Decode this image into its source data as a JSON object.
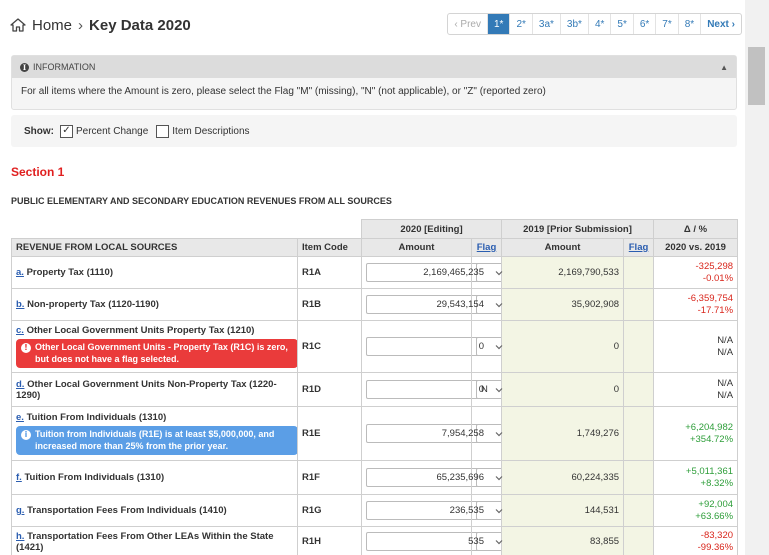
{
  "breadcrumb": {
    "home": "Home",
    "current": "Key Data 2020"
  },
  "pager": {
    "prev": "‹ Prev",
    "pages": [
      "1*",
      "2*",
      "3a*",
      "3b*",
      "4*",
      "5*",
      "6*",
      "7*",
      "8*"
    ],
    "active": "1*",
    "next": "Next ›"
  },
  "info": {
    "title": "INFORMATION",
    "text": "For all items where the Amount is zero, please select the Flag \"M\" (missing), \"N\" (not applicable), or \"Z\" (reported zero)"
  },
  "show": {
    "label": "Show:",
    "percent_change": "Percent Change",
    "percent_change_checked": true,
    "item_descriptions": "Item Descriptions",
    "item_descriptions_checked": false
  },
  "section": {
    "title": "Section 1",
    "subtitle": "PUBLIC ELEMENTARY AND SECONDARY EDUCATION REVENUES FROM ALL SOURCES"
  },
  "table": {
    "group_current": "2020 [Editing]",
    "group_prior": "2019 [Prior Submission]",
    "group_delta": "Δ / %",
    "col_name": "REVENUE FROM LOCAL SOURCES",
    "col_code": "Item Code",
    "col_amount": "Amount",
    "col_flag": "Flag",
    "col_prior_amount": "Amount",
    "col_prior_flag": "Flag",
    "col_delta": "2020 vs. 2019",
    "rows": [
      {
        "key": "a.",
        "name": "Property Tax (1110)",
        "code": "R1A",
        "amount": "2,169,465,235",
        "flag": "",
        "prior": "2,169,790,533",
        "delta1": "-325,298",
        "delta2": "-0.01%",
        "tone": "neg",
        "alert": "",
        "alert_type": ""
      },
      {
        "key": "b.",
        "name": "Non-property Tax (1120-1190)",
        "code": "R1B",
        "amount": "29,543,154",
        "flag": "",
        "prior": "35,902,908",
        "delta1": "-6,359,754",
        "delta2": "-17.71%",
        "tone": "neg",
        "alert": "",
        "alert_type": ""
      },
      {
        "key": "c.",
        "name": "Other Local Government Units Property Tax (1210)",
        "code": "R1C",
        "amount": "0",
        "flag": "",
        "prior": "0",
        "delta1": "N/A",
        "delta2": "N/A",
        "tone": "na",
        "alert": "Other Local Government Units - Property Tax (R1C) is zero, but does not have a flag selected.",
        "alert_type": "red"
      },
      {
        "key": "d.",
        "name": "Other Local Government Units Non-Property Tax (1220-1290)",
        "code": "R1D",
        "amount": "0",
        "flag": "N",
        "prior": "0",
        "delta1": "N/A",
        "delta2": "N/A",
        "tone": "na",
        "alert": "",
        "alert_type": ""
      },
      {
        "key": "e.",
        "name": "Tuition From Individuals (1310)",
        "code": "R1E",
        "amount": "7,954,258",
        "flag": "",
        "prior": "1,749,276",
        "delta1": "+6,204,982",
        "delta2": "+354.72%",
        "tone": "pos",
        "alert": "Tuition from Individuals (R1E) is at least $5,000,000, and increased more than 25% from the prior year.",
        "alert_type": "blue"
      },
      {
        "key": "f.",
        "name": "Tuition From Individuals (1310)",
        "code": "R1F",
        "amount": "65,235,696",
        "flag": "",
        "prior": "60,224,335",
        "delta1": "+5,011,361",
        "delta2": "+8.32%",
        "tone": "pos",
        "alert": "",
        "alert_type": ""
      },
      {
        "key": "g.",
        "name": "Transportation Fees From Individuals (1410)",
        "code": "R1G",
        "amount": "236,535",
        "flag": "",
        "prior": "144,531",
        "delta1": "+92,004",
        "delta2": "+63.66%",
        "tone": "pos",
        "alert": "",
        "alert_type": ""
      },
      {
        "key": "h.",
        "name": "Transportation Fees From Other LEAs Within the State (1421)",
        "code": "R1H",
        "amount": "535",
        "flag": "",
        "prior": "83,855",
        "delta1": "-83,320",
        "delta2": "-99.36%",
        "tone": "neg",
        "alert": "",
        "alert_type": ""
      }
    ]
  }
}
